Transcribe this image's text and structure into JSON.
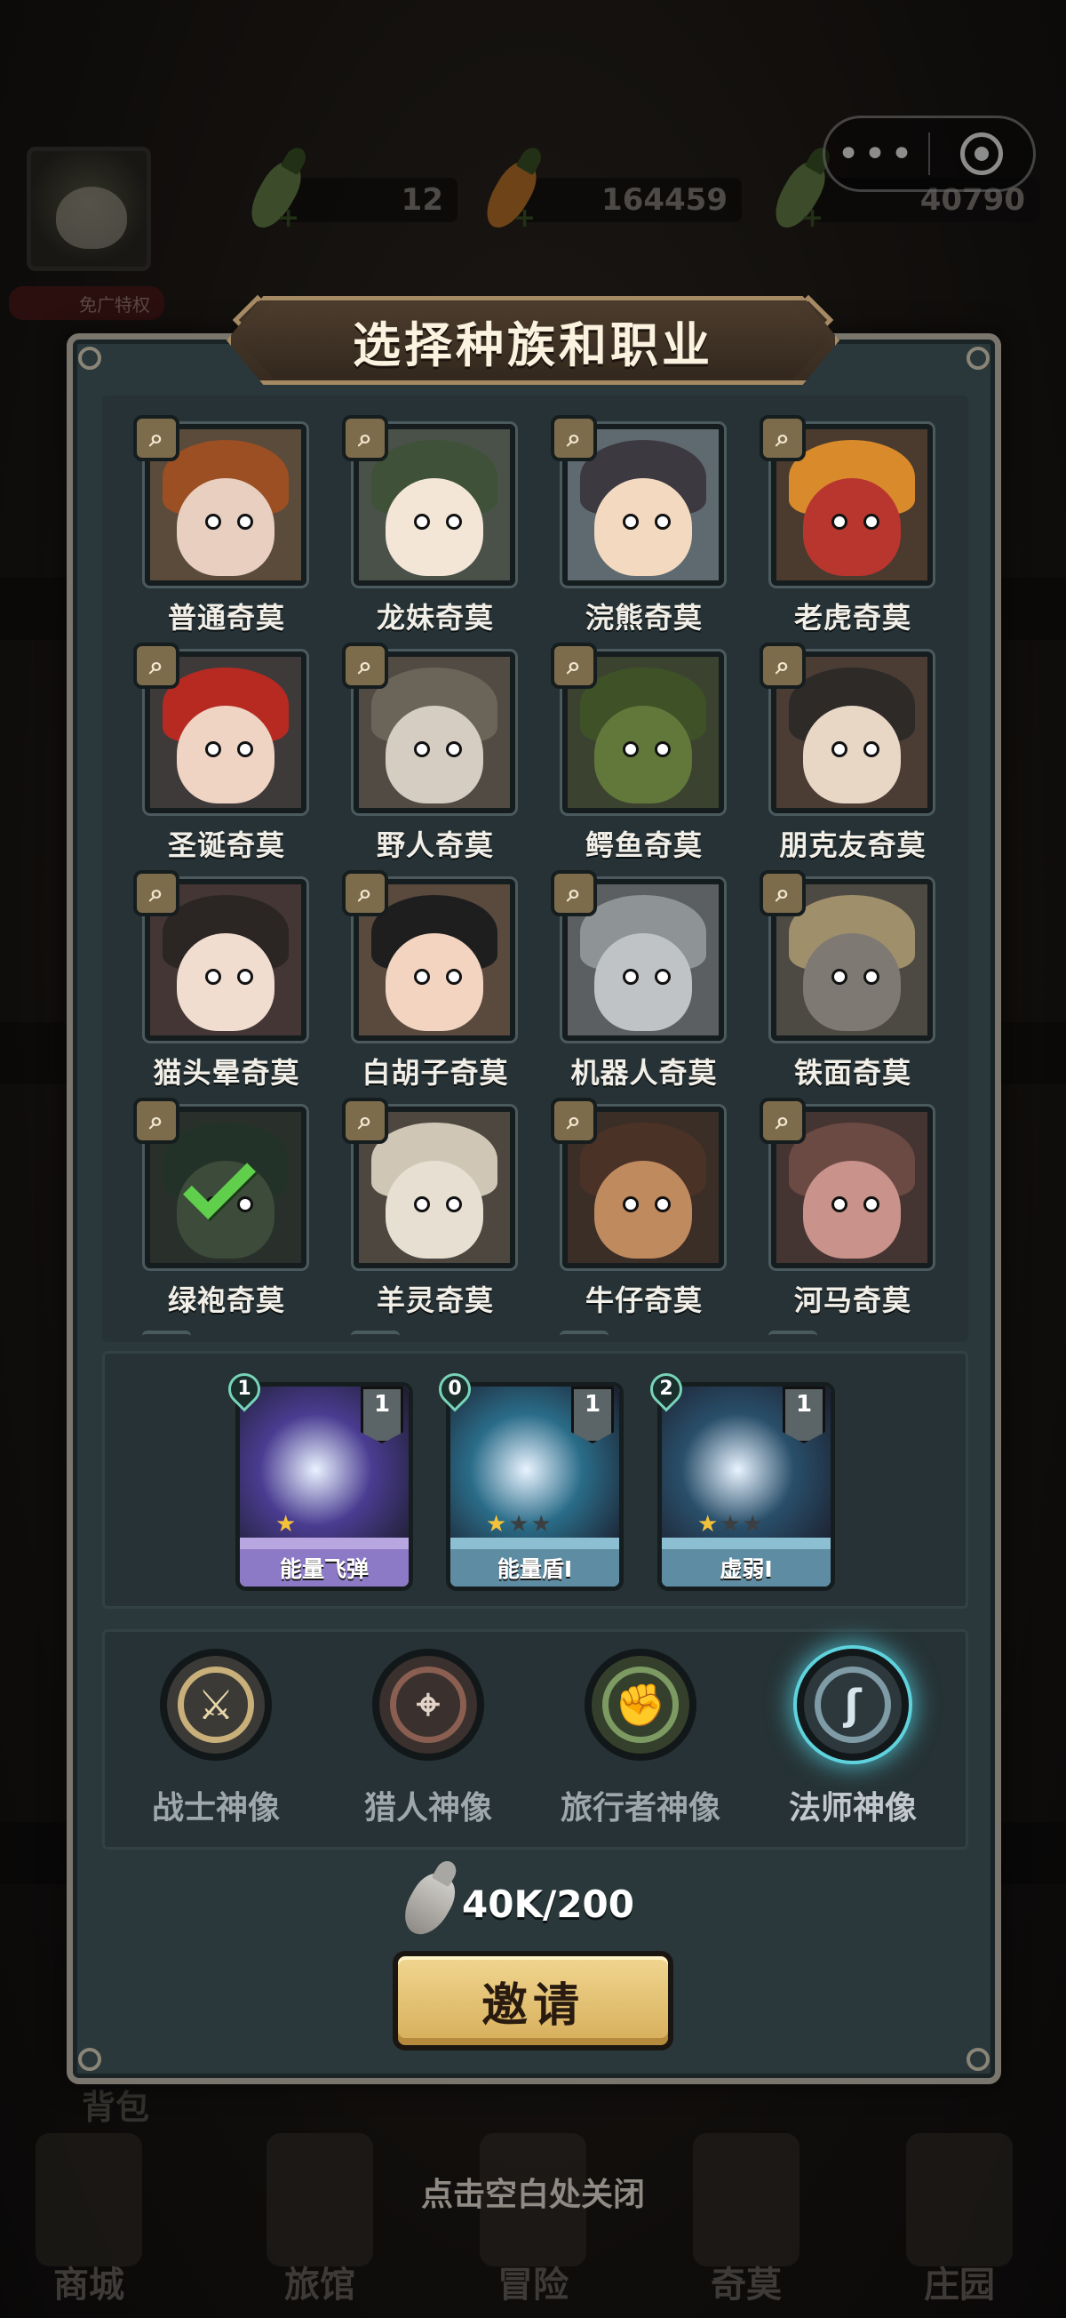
{
  "top_bar": {
    "resources": [
      {
        "icon": "green-carrot-icon",
        "value": "12"
      },
      {
        "icon": "orange-carrot-icon",
        "value": "164459"
      },
      {
        "icon": "green-carrot-icon",
        "value": "40790"
      }
    ],
    "ad_free_label": "免广特权"
  },
  "capsule": {
    "more_glyph": "•••"
  },
  "modal": {
    "title": "选择种族和职业",
    "races": [
      {
        "name": "普通奇莫",
        "face": "#e8cfc0",
        "hat": "#9b4f23",
        "bg": "#5b4b3b"
      },
      {
        "name": "龙妹奇莫",
        "face": "#f3e6d7",
        "hat": "#3f5138",
        "bg": "#4a5149"
      },
      {
        "name": "浣熊奇莫",
        "face": "#f2d9c0",
        "hat": "#3d3940",
        "bg": "#5e6a6f"
      },
      {
        "name": "老虎奇莫",
        "face": "#b9362f",
        "hat": "#d98a2b",
        "bg": "#4a3b2e"
      },
      {
        "name": "圣诞奇莫",
        "face": "#efd4c4",
        "hat": "#b62a22",
        "bg": "#3f3a3a"
      },
      {
        "name": "野人奇莫",
        "face": "#d5cdc2",
        "hat": "#6b6458",
        "bg": "#514b43"
      },
      {
        "name": "鳄鱼奇莫",
        "face": "#62783b",
        "hat": "#3f5227",
        "bg": "#3b4330"
      },
      {
        "name": "朋克友奇莫",
        "face": "#e9d7c6",
        "hat": "#2d2a28",
        "bg": "#4b3d34"
      },
      {
        "name": "猫头晕奇莫",
        "face": "#f0ddd0",
        "hat": "#2b2523",
        "bg": "#433634"
      },
      {
        "name": "白胡子奇莫",
        "face": "#f2d4c1",
        "hat": "#1f1e1f",
        "bg": "#5a4a3e"
      },
      {
        "name": "机器人奇莫",
        "face": "#bfc3c6",
        "hat": "#8e9396",
        "bg": "#5b5f61"
      },
      {
        "name": "铁面奇莫",
        "face": "#7e7a73",
        "hat": "#a08f6b",
        "bg": "#4d4a43"
      },
      {
        "name": "绿袍奇莫",
        "face": "#3c4b3a",
        "hat": "#233228",
        "bg": "#29302b",
        "selected": true
      },
      {
        "name": "羊灵奇莫",
        "face": "#e6dfd2",
        "hat": "#cfc6b6",
        "bg": "#4e4740"
      },
      {
        "name": "牛仔奇莫",
        "face": "#c08a5f",
        "hat": "#4b3226",
        "bg": "#3a2e26"
      },
      {
        "name": "河马奇莫",
        "face": "#c9928a",
        "hat": "#6b4a43",
        "bg": "#453532"
      }
    ],
    "search_glyph": "⌕",
    "skills": [
      {
        "name": "能量飞弹",
        "cost": "1",
        "level": "1",
        "stars": 1,
        "max_stars": 1,
        "frame": "#b7a6e0",
        "art": "#4a3c91",
        "bar": "#8d7ac7"
      },
      {
        "name": "能量盾I",
        "cost": "0",
        "level": "1",
        "stars": 1,
        "max_stars": 3,
        "frame": "#8dbfd2",
        "art": "#2a6c88",
        "bar": "#5e8da3"
      },
      {
        "name": "虚弱I",
        "cost": "2",
        "level": "1",
        "stars": 1,
        "max_stars": 3,
        "frame": "#8dbfd2",
        "art": "#294f6a",
        "bar": "#5e8da3"
      }
    ],
    "classes": [
      {
        "name": "战士神像",
        "icon": "sword-icon",
        "glyph": "⚔",
        "ring": "#c9b07a",
        "inner": "#3b3a36",
        "color": "#e9d7a8"
      },
      {
        "name": "猎人神像",
        "icon": "crosshair-icon",
        "glyph": "⌖",
        "ring": "#8a5f52",
        "inner": "#3a302d",
        "color": "#e3d3c8"
      },
      {
        "name": "旅行者神像",
        "icon": "fist-icon",
        "glyph": "✊",
        "ring": "#7d9a63",
        "inner": "#34402c",
        "color": "#a8d187"
      },
      {
        "name": "法师神像",
        "icon": "staff-icon",
        "glyph": "ʃ",
        "ring": "#7f9ba6",
        "inner": "#2d383d",
        "color": "#d7e6ec",
        "selected": true
      }
    ],
    "cost_text": "40K/200",
    "invite_label": "邀请",
    "close_hint": "点击空白处关闭"
  },
  "background": {
    "bag_label": "背包",
    "nav": [
      "商城",
      "旅馆",
      "冒险",
      "奇莫",
      "庄园"
    ]
  }
}
